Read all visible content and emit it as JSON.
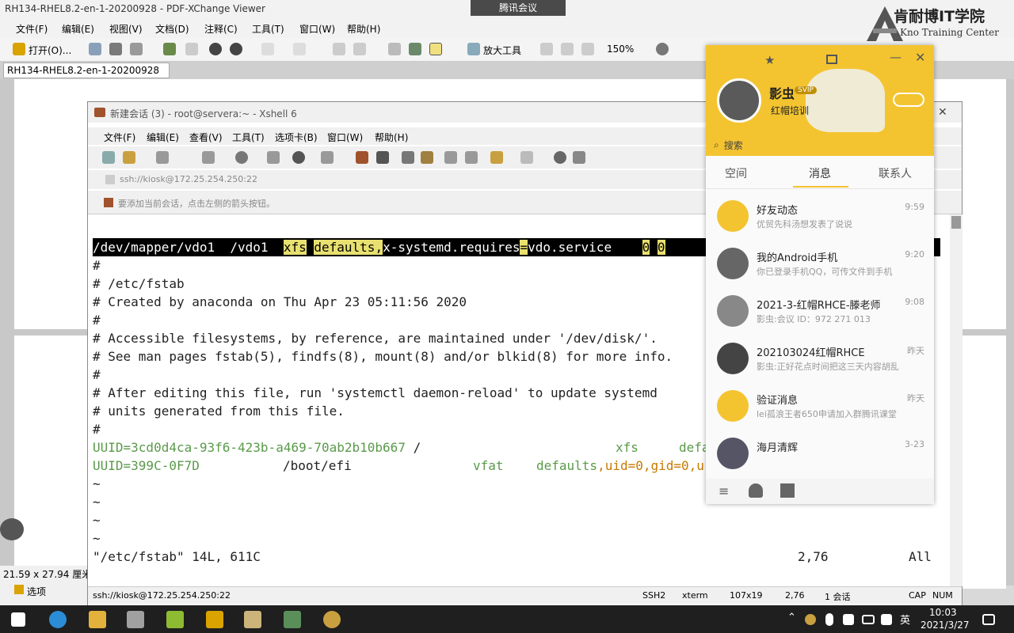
{
  "pdf": {
    "title": "RH134-RHEL8.2-en-1-20200928 - PDF-XChange Viewer",
    "meeting_tab": "腾讯会议",
    "menu": [
      "文件(F)",
      "编辑(E)",
      "视图(V)",
      "文档(D)",
      "注释(C)",
      "工具(T)",
      "窗口(W)",
      "帮助(H)"
    ],
    "toolbar": {
      "open": "打开(O)...",
      "zoom_tool": "放大工具",
      "zoom": "150%"
    },
    "doc_tab": "RH134-RHEL8.2-en-1-20200928",
    "page_size": "21.59 x 27.94 厘米",
    "options": "选项"
  },
  "logo": {
    "title": "肯耐博IT学院",
    "subtitle": "Kno Training Center"
  },
  "xshell": {
    "title": "新建会话 (3) - root@servera:~ - Xshell 6",
    "menu": [
      "文件(F)",
      "编辑(E)",
      "查看(V)",
      "工具(T)",
      "选项卡(B)",
      "窗口(W)",
      "帮助(H)"
    ],
    "address": "ssh://kiosk@172.25.254.250:22",
    "hint": "要添加当前会话，点击左侧的箭头按钮。",
    "terminal": {
      "hl": {
        "dev": "/dev/mapper/vdo1  /vdo1  ",
        "fs": "xfs",
        "opt": "defaults",
        "req": "x-systemd.requires",
        "svc": "vdo.service",
        "zero1": "0",
        "zero2": "0"
      },
      "lines": [
        "#",
        "# /etc/fstab",
        "# Created by anaconda on Thu Apr 23 05:11:56 2020",
        "#",
        "# Accessible filesystems, by reference, are maintained under '/dev/disk/'.",
        "# See man pages fstab(5), findfs(8), mount(8) and/or blkid(8) for more info.",
        "#",
        "# After editing this file, run 'systemctl daemon-reload' to update systemd",
        "# units generated from this file.",
        "#"
      ],
      "uuid1": {
        "key": "UUID=3cd0d4ca-93f6-423b-a469-70ab2b10b667",
        "mount": "/",
        "fs": "xfs",
        "opt": "defa"
      },
      "uuid2": {
        "key": "UUID=399C-0F7D",
        "mount": "/boot/efi",
        "fs": "vfat",
        "opt": "defaults",
        "opt_rest": ",uid=0,gid=0,u"
      },
      "tilde": "~",
      "status_file": "\"/etc/fstab\" 14L, 611C",
      "status_pos": "2,76",
      "status_all": "All"
    },
    "status": {
      "conn": "ssh://kiosk@172.25.254.250:22",
      "proto": "SSH2",
      "term": "xterm",
      "size": "107x19",
      "pos": "2,76",
      "sessions": "1 会话",
      "cap": "CAP",
      "num": "NUM"
    }
  },
  "qq": {
    "name": "影虫",
    "badge": "SVIP",
    "sign": "红帽培训",
    "search": "搜索",
    "tabs": [
      "空间",
      "消息",
      "联系人"
    ],
    "items": [
      {
        "title": "好友动态",
        "sub": "优贸先科汤想发表了说说",
        "time": "9:59"
      },
      {
        "title": "我的Android手机",
        "sub": "你已登录手机QQ，可传文件到手机",
        "time": "9:20"
      },
      {
        "title": "2021-3-红帽RHCE-滕老师",
        "sub": "影虫:会议 ID：972 271 013",
        "time": "9:08"
      },
      {
        "title": "202103024红帽RHCE",
        "sub": "影虫:正好花点时间把这三天内容胡乱",
        "time": "昨天"
      },
      {
        "title": "验证消息",
        "sub": "lei孤浪王者650申请加入群腾讯课堂",
        "time": "昨天"
      },
      {
        "title": "海月清辉",
        "sub": "",
        "time": "3-23"
      }
    ]
  },
  "taskbar": {
    "ime": "英",
    "time": "10:03",
    "date": "2021/3/27"
  },
  "colors": {
    "qq_yellow": "#f4c430",
    "terminal_hl": "#e8e070",
    "taskbar": "#1f1f1f"
  }
}
